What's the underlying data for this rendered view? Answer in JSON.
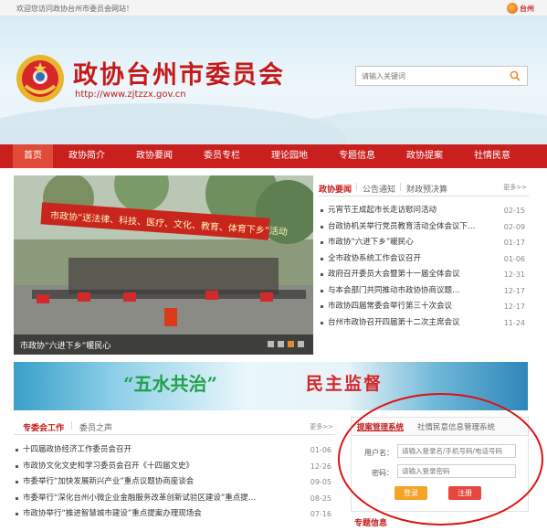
{
  "topbar": {
    "welcome": "欢迎您访问政协台州市委员会网站！",
    "logo_text": "台州"
  },
  "header": {
    "title": "政协台州市委员会",
    "url": "http://www.zjtzzx.gov.cn",
    "search_placeholder": "请输入关键词"
  },
  "nav": {
    "items": [
      {
        "label": "首页",
        "active": true
      },
      {
        "label": "政协简介"
      },
      {
        "label": "政协要闻"
      },
      {
        "label": "委员专栏"
      },
      {
        "label": "理论园地"
      },
      {
        "label": "专题信息"
      },
      {
        "label": "政协提案"
      },
      {
        "label": "社情民意"
      }
    ]
  },
  "photo": {
    "caption": "市政协“六进下乡”暖民心",
    "banner_text": "市政协“送法律、科技、医疗、文化、教育、体育下乡”活动"
  },
  "news": {
    "tabs": [
      "政协要闻",
      "公告通知",
      "财政预决算"
    ],
    "more": "更多>>",
    "items": [
      {
        "title": "元宵节王成起市长走访慰问活动",
        "date": "02-15"
      },
      {
        "title": "台政协机关举行党员教育活动全体会议下…",
        "date": "02-09"
      },
      {
        "title": "市政协“六进下乡”暖民心",
        "date": "01-17"
      },
      {
        "title": "全市政协系统工作会议召开",
        "date": "01-06"
      },
      {
        "title": "政府召开委员大会暨第十一届全体会议",
        "date": "12-31"
      },
      {
        "title": "与本会部门共同推动市政协协商议题…",
        "date": "12-17"
      },
      {
        "title": "市政协四届常委会举行第三十次会议",
        "date": "12-17"
      },
      {
        "title": "台州市政协召开四届第十二次主席会议",
        "date": "11-24"
      }
    ]
  },
  "banner": {
    "left_text": "“五水共治”",
    "right_text": "民主监督"
  },
  "work": {
    "tabs": [
      "专委会工作",
      "委员之声"
    ],
    "more": "更多>>",
    "items": [
      {
        "title": "十四届政协经济工作委员会召开",
        "date": "01-06"
      },
      {
        "title": "市政协文化文史和学习委员会召开《十四届文史》",
        "date": "12-26"
      },
      {
        "title": "市委举行“加快发展新兴产业”重点议题协商座谈会",
        "date": "09-05"
      },
      {
        "title": "市委举行“深化台州小微企业金融服务改革创新试验区建设”重点提…",
        "date": "08-25"
      },
      {
        "title": "市政协举行“推进智慧城市建设”重点提案办理现场会",
        "date": "07-16"
      }
    ]
  },
  "petition": {
    "tabs": [
      "提案管理系统",
      "社情民意信息管理系统"
    ],
    "user_label": "用户名：",
    "user_placeholder": "请输入登录名/手机号码/电话号码",
    "pwd_label": "密码：",
    "pwd_placeholder": "请输入登录密码",
    "login": "登录",
    "register": "注册"
  },
  "bottom_tab": "专题信息"
}
